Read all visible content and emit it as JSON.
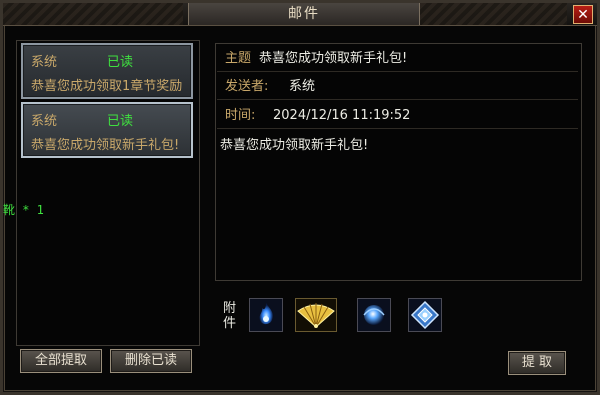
{
  "window": {
    "title": "邮件",
    "close_glyph": "✕"
  },
  "mail_list": {
    "items": [
      {
        "sender": "系统",
        "status": "已读",
        "preview": "恭喜您成功领取1章节奖励"
      },
      {
        "sender": "系统",
        "status": "已读",
        "preview": "恭喜您成功领取新手礼包!"
      }
    ],
    "overflow_text": "靴 * 1"
  },
  "buttons": {
    "collect_all": "全部提取",
    "delete_read": "删除已读",
    "collect": "提 取"
  },
  "detail": {
    "subject_label": "主题",
    "subject": "恭喜您成功领取新手礼包!",
    "sender_label": "发送者:",
    "sender": "系统",
    "time_label": "时间:",
    "time": "2024/12/16 11:19:52",
    "body": "恭喜您成功领取新手礼包!"
  },
  "attachments": {
    "label": "附件",
    "items": [
      "blue-flame-icon",
      "golden-fan-icon",
      "blue-orb-icon",
      "crystal-emblem-icon"
    ]
  },
  "colors": {
    "read_status": "#3fe03f",
    "sender_text": "#c9a86a",
    "close_button": "#b81e14"
  }
}
